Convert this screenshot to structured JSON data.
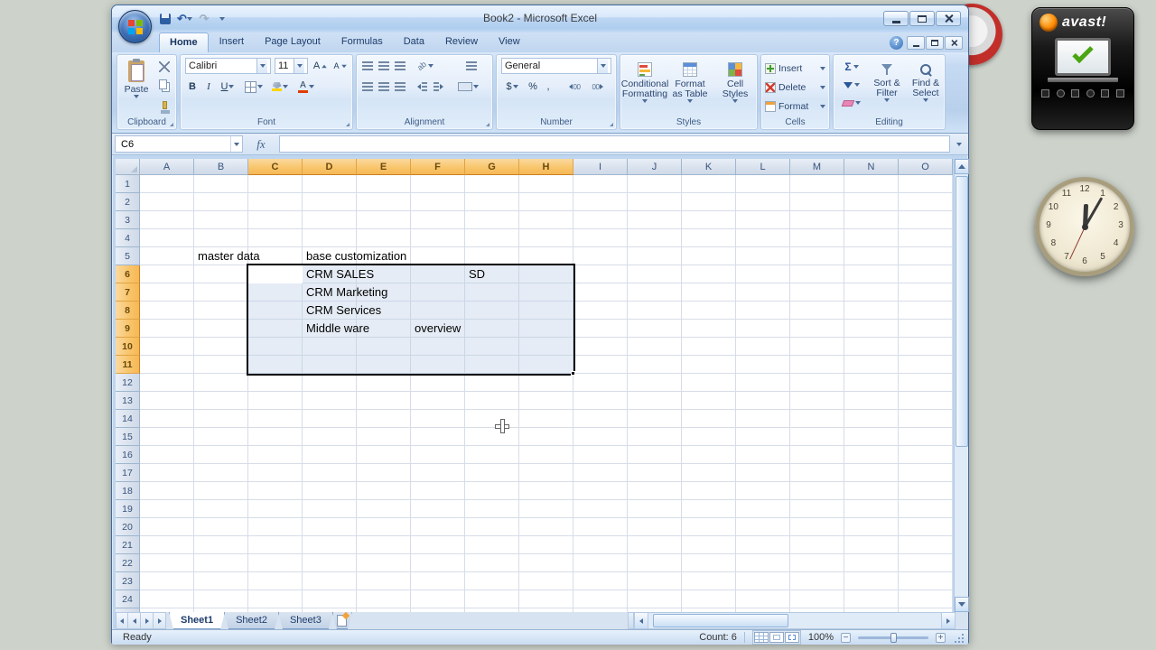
{
  "window": {
    "title": "Book2 - Microsoft Excel"
  },
  "ribbon": {
    "tabs": [
      "Home",
      "Insert",
      "Page Layout",
      "Formulas",
      "Data",
      "Review",
      "View"
    ],
    "active_tab": "Home",
    "help": "?",
    "clipboard": {
      "label": "Clipboard",
      "paste": "Paste"
    },
    "font": {
      "label": "Font",
      "name": "Calibri",
      "size": "11",
      "bold": "B",
      "italic": "I",
      "underline": "U",
      "grow": "A",
      "shrink": "A"
    },
    "alignment": {
      "label": "Alignment"
    },
    "number": {
      "label": "Number",
      "format": "General",
      "currency": "$",
      "percent": "%",
      "comma": ",",
      "dec": "00"
    },
    "styles": {
      "label": "Styles",
      "cf1": "Conditional",
      "cf2": "Formatting",
      "ft1": "Format",
      "ft2": "as Table",
      "cs1": "Cell",
      "cs2": "Styles"
    },
    "cells": {
      "label": "Cells",
      "insert": "Insert",
      "delete": "Delete",
      "format": "Format"
    },
    "editing": {
      "label": "Editing",
      "autosum": "Σ",
      "sort1": "Sort &",
      "sort2": "Filter",
      "find1": "Find &",
      "find2": "Select"
    }
  },
  "formula": {
    "name_box": "C6",
    "fx": "fx"
  },
  "grid": {
    "columns": [
      "A",
      "B",
      "C",
      "D",
      "E",
      "F",
      "G",
      "H",
      "I",
      "J",
      "K",
      "L",
      "M",
      "N",
      "O"
    ],
    "row_count": 25,
    "highlight_cols": [
      "C",
      "D",
      "E",
      "F",
      "G",
      "H"
    ],
    "highlight_rows": [
      6,
      7,
      8,
      9,
      10,
      11
    ],
    "selection": {
      "range": "C6:H11",
      "active_cell": "C6"
    },
    "cells": [
      {
        "ref": "B5",
        "text": "master data"
      },
      {
        "ref": "D5",
        "text": "base customization"
      },
      {
        "ref": "D6",
        "text": "CRM SALES"
      },
      {
        "ref": "G6",
        "text": "SD"
      },
      {
        "ref": "D7",
        "text": "CRM Marketing"
      },
      {
        "ref": "D8",
        "text": "CRM Services"
      },
      {
        "ref": "D9",
        "text": "Middle ware"
      },
      {
        "ref": "F9",
        "text": "overview"
      }
    ]
  },
  "sheets": {
    "tabs": [
      "Sheet1",
      "Sheet2",
      "Sheet3"
    ],
    "active": "Sheet1"
  },
  "status": {
    "ready": "Ready",
    "count": "Count: 6",
    "zoom": "100%"
  },
  "desktop": {
    "avast": {
      "brand": "avast!"
    },
    "clock": {
      "time": "12:05",
      "numerals": [
        "12",
        "1",
        "2",
        "3",
        "4",
        "5",
        "6",
        "7",
        "8",
        "9",
        "10",
        "11"
      ]
    }
  }
}
